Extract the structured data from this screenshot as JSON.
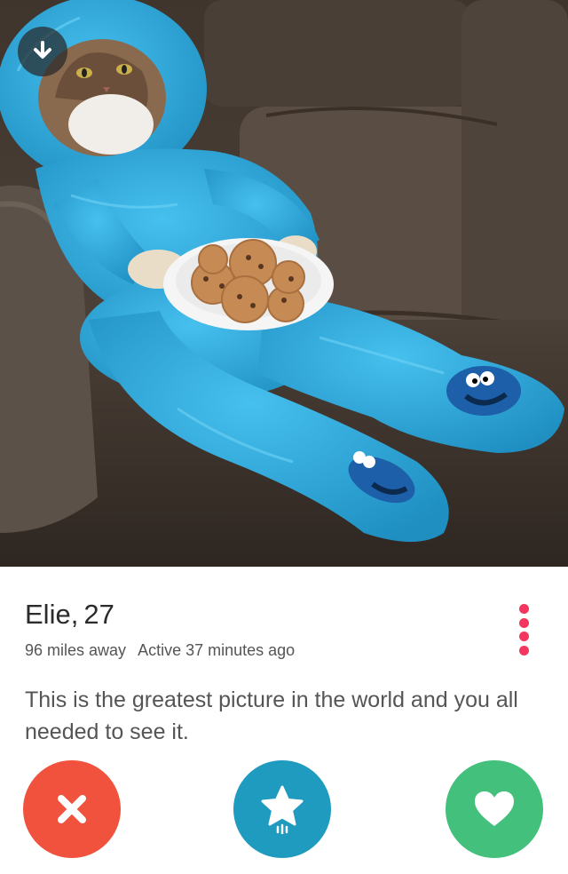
{
  "profile": {
    "name": "Elie",
    "age": "27",
    "distance": "96 miles away",
    "active": "Active 37 minutes ago",
    "bio": "This is the greatest picture in the world and you all needed to see it."
  },
  "icons": {
    "download": "download-arrow-icon",
    "more": "more-dots-icon",
    "nope": "x-icon",
    "super_like": "star-icon",
    "like": "heart-icon"
  },
  "colors": {
    "nope": "#f0523d",
    "super_like": "#1e9bbf",
    "like": "#42c07c",
    "more_dots": "#f2365d",
    "costume": "#2aa7d8",
    "couch": "#4a3e35"
  }
}
